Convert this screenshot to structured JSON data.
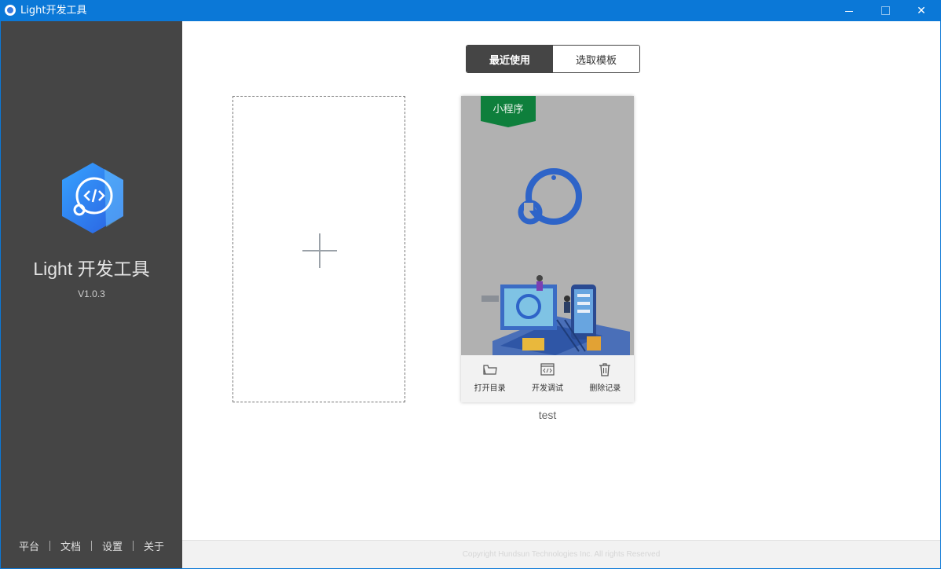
{
  "window": {
    "title": "Light开发工具",
    "minimize_icon": "minimize-icon",
    "maximize_icon": "maximize-icon",
    "close_icon": "close-icon",
    "close_glyph": "✕"
  },
  "sidebar": {
    "app_name": "Light 开发工具",
    "version": "V1.0.3",
    "links": [
      "平台",
      "文档",
      "设置",
      "关于"
    ]
  },
  "tabs": [
    {
      "label": "最近使用",
      "active": true
    },
    {
      "label": "选取模板",
      "active": false
    }
  ],
  "new_project": {
    "icon": "plus-icon"
  },
  "project": {
    "type_badge": "小程序",
    "name": "test",
    "badge_color": "#0e7f3c",
    "actions": [
      {
        "label": "打开目录",
        "icon": "folder-icon"
      },
      {
        "label": "开发调试",
        "icon": "code-window-icon"
      },
      {
        "label": "删除记录",
        "icon": "trash-icon"
      }
    ]
  },
  "footer": {
    "copyright": "Copyright Hundsun Technologies Inc. All rights Reserved"
  },
  "colors": {
    "titlebar": "#0b78d7",
    "sidebar": "#454545",
    "accent_logo": "#2f7de6"
  }
}
